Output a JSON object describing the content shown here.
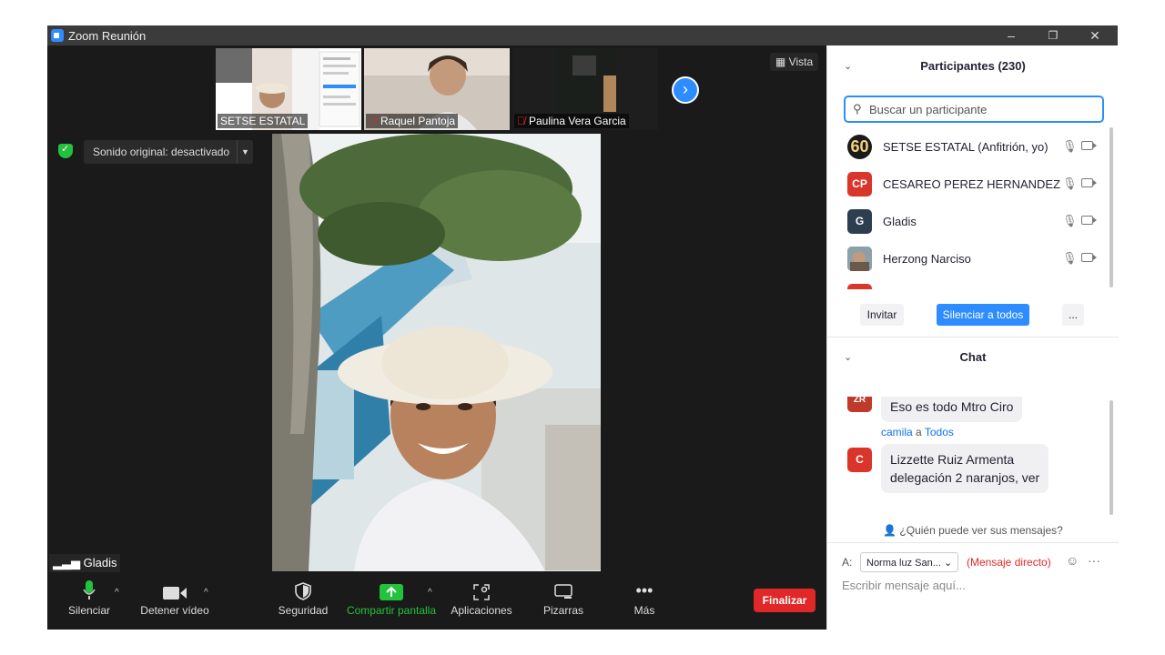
{
  "window": {
    "title": "Zoom Reunión",
    "controls": [
      "–",
      "❐",
      "✕"
    ]
  },
  "gallery": {
    "thumbnails": [
      {
        "name": "SETSE ESTATAL",
        "muted": false
      },
      {
        "name": "Raquel Pantoja",
        "muted": true
      },
      {
        "name": "Paulina Vera Garcia",
        "muted": true
      }
    ],
    "view_label": "Vista"
  },
  "audio": {
    "original_sound": "Sonido original: desactivado"
  },
  "speaker": {
    "name": "Gladis"
  },
  "toolbar": {
    "mute": "Silenciar",
    "stop_video": "Detener vídeo",
    "security": "Seguridad",
    "share": "Compartir pantalla",
    "apps": "Aplicaciones",
    "whiteboards": "Pizarras",
    "more": "Más",
    "end": "Finalizar"
  },
  "participants": {
    "header": "Participantes (230)",
    "search_placeholder": "Buscar un participante",
    "list": [
      {
        "name": "SETSE ESTATAL (Anfitrión, yo)",
        "avatar": "60",
        "avatar_color": "#1a1a1a"
      },
      {
        "name": "CESAREO PEREZ HERNANDEZ",
        "avatar": "CP",
        "avatar_color": "#d9352a"
      },
      {
        "name": "Gladis",
        "avatar": "G",
        "avatar_color": "#2c3e50"
      },
      {
        "name": "Herzong Narciso",
        "avatar": "",
        "avatar_color": "#7a8a6a"
      }
    ],
    "invite": "Invitar",
    "mute_all": "Silenciar a todos",
    "more": "..."
  },
  "chat": {
    "header": "Chat",
    "messages": [
      {
        "avatar": "ZR",
        "avatar_color": "#c0392b",
        "text": "Eso es todo Mtro Ciro"
      },
      {
        "sender": "camila",
        "to_word": "a",
        "recipient": "Todos",
        "avatar": "C",
        "avatar_color": "#d9352a",
        "text_line1": "Lizzette Ruiz Armenta",
        "text_line2": "delegación 2 naranjos, ver"
      }
    ],
    "who_sees": "¿Quién puede ver sus mensajes?",
    "to_label": "A:",
    "recipient_select": "Norma luz San...",
    "direct_message": "(Mensaje directo)",
    "input_placeholder": "Escribir mensaje aquí..."
  }
}
